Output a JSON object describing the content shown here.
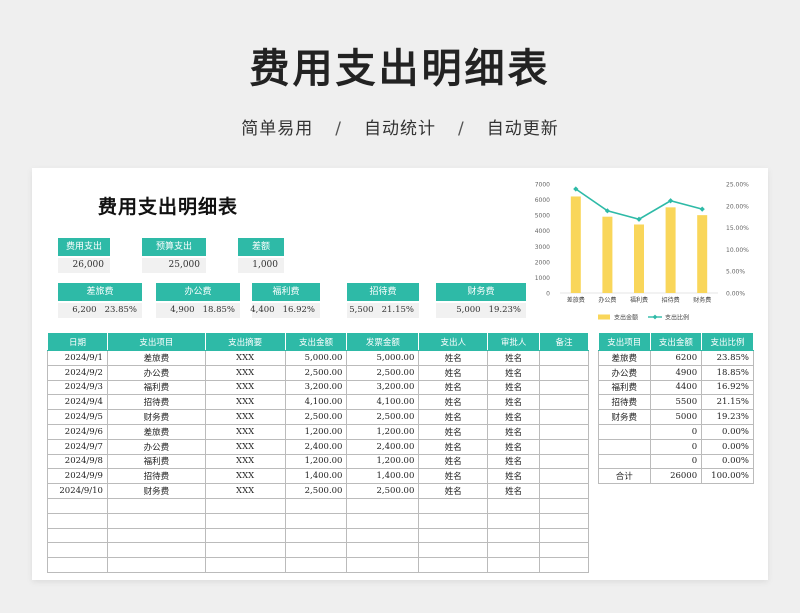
{
  "hero": {
    "title": "费用支出明细表",
    "sub1": "简单易用",
    "sep1": "/",
    "sub2": "自动统计",
    "sep2": "/",
    "sub3": "自动更新"
  },
  "sheet_title": "费用支出明细表",
  "kpis": [
    {
      "label": "费用支出",
      "value": "26,000"
    },
    {
      "label": "预算支出",
      "value": "25,000"
    },
    {
      "label": "差额",
      "value": "1,000"
    }
  ],
  "cats": [
    {
      "label": "差旅费",
      "amount": "6,200",
      "pct": "23.85%"
    },
    {
      "label": "办公费",
      "amount": "4,900",
      "pct": "18.85%"
    },
    {
      "label": "福利费",
      "amount": "4,400",
      "pct": "16.92%"
    },
    {
      "label": "招待费",
      "amount": "5,500",
      "pct": "21.15%"
    },
    {
      "label": "财务费",
      "amount": "5,000",
      "pct": "19.23%"
    }
  ],
  "main_table": {
    "headers": [
      "日期",
      "支出项目",
      "支出摘要",
      "支出金额",
      "发票金额",
      "支出人",
      "审批人",
      "备注"
    ],
    "rows": [
      [
        "2024/9/1",
        "差旅费",
        "XXX",
        "5,000.00",
        "5,000.00",
        "姓名",
        "姓名",
        ""
      ],
      [
        "2024/9/2",
        "办公费",
        "XXX",
        "2,500.00",
        "2,500.00",
        "姓名",
        "姓名",
        ""
      ],
      [
        "2024/9/3",
        "福利费",
        "XXX",
        "3,200.00",
        "3,200.00",
        "姓名",
        "姓名",
        ""
      ],
      [
        "2024/9/4",
        "招待费",
        "XXX",
        "4,100.00",
        "4,100.00",
        "姓名",
        "姓名",
        ""
      ],
      [
        "2024/9/5",
        "财务费",
        "XXX",
        "2,500.00",
        "2,500.00",
        "姓名",
        "姓名",
        ""
      ],
      [
        "2024/9/6",
        "差旅费",
        "XXX",
        "1,200.00",
        "1,200.00",
        "姓名",
        "姓名",
        ""
      ],
      [
        "2024/9/7",
        "办公费",
        "XXX",
        "2,400.00",
        "2,400.00",
        "姓名",
        "姓名",
        ""
      ],
      [
        "2024/9/8",
        "福利费",
        "XXX",
        "1,200.00",
        "1,200.00",
        "姓名",
        "姓名",
        ""
      ],
      [
        "2024/9/9",
        "招待费",
        "XXX",
        "1,400.00",
        "1,400.00",
        "姓名",
        "姓名",
        ""
      ],
      [
        "2024/9/10",
        "财务费",
        "XXX",
        "2,500.00",
        "2,500.00",
        "姓名",
        "姓名",
        ""
      ],
      [
        "",
        "",
        "",
        "",
        "",
        "",
        "",
        ""
      ],
      [
        "",
        "",
        "",
        "",
        "",
        "",
        "",
        ""
      ],
      [
        "",
        "",
        "",
        "",
        "",
        "",
        "",
        ""
      ],
      [
        "",
        "",
        "",
        "",
        "",
        "",
        "",
        ""
      ],
      [
        "",
        "",
        "",
        "",
        "",
        "",
        "",
        ""
      ]
    ]
  },
  "side_table": {
    "headers": [
      "支出项目",
      "支出金额",
      "支出比例"
    ],
    "rows": [
      [
        "差旅费",
        "6200",
        "23.85%"
      ],
      [
        "办公费",
        "4900",
        "18.85%"
      ],
      [
        "福利费",
        "4400",
        "16.92%"
      ],
      [
        "招待费",
        "5500",
        "21.15%"
      ],
      [
        "财务费",
        "5000",
        "19.23%"
      ],
      [
        "",
        "0",
        "0.00%"
      ],
      [
        "",
        "0",
        "0.00%"
      ],
      [
        "",
        "0",
        "0.00%"
      ],
      [
        "合计",
        "26000",
        "100.00%"
      ]
    ]
  },
  "chart_data": {
    "type": "bar",
    "categories": [
      "差旅费",
      "办公费",
      "福利费",
      "招待费",
      "财务费"
    ],
    "series": [
      {
        "name": "支出金额",
        "type": "bar",
        "axis": "left",
        "values": [
          6200,
          4900,
          4400,
          5500,
          5000
        ],
        "color": "#f9d65a"
      },
      {
        "name": "支出比例",
        "type": "line",
        "axis": "right",
        "values": [
          23.85,
          18.85,
          16.92,
          21.15,
          19.23
        ],
        "color": "#2ebaa7"
      }
    ],
    "ylim_left": [
      0,
      7000
    ],
    "yticks_left": [
      "0",
      "1000",
      "2000",
      "3000",
      "4000",
      "5000",
      "6000",
      "7000"
    ],
    "ylim_right": [
      0,
      25
    ],
    "yticks_right": [
      "0.00%",
      "5.00%",
      "10.00%",
      "15.00%",
      "20.00%",
      "25.00%"
    ],
    "legend_position": "bottom",
    "grid": false
  }
}
